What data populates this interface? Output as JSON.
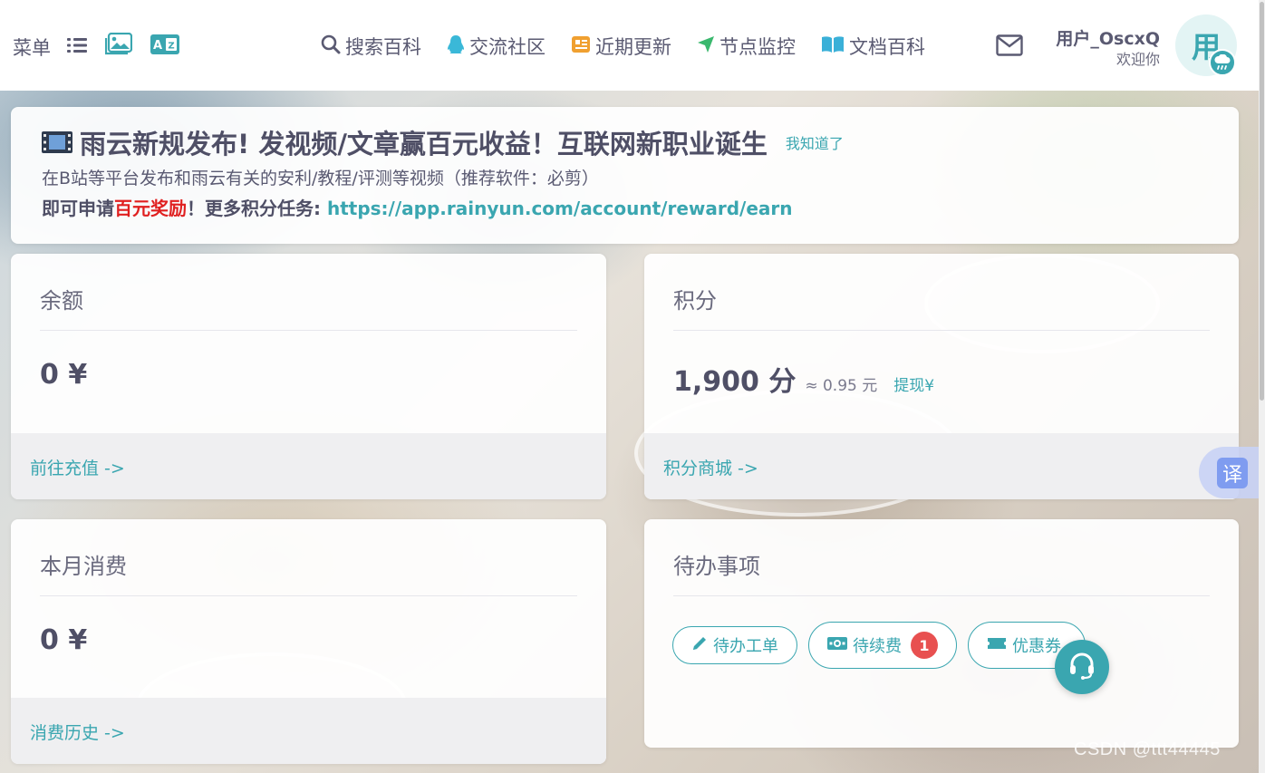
{
  "header": {
    "menu_label": "菜单",
    "nav": [
      {
        "label": "搜索百科",
        "icon": "search-icon"
      },
      {
        "label": "交流社区",
        "icon": "qq-penguin-icon"
      },
      {
        "label": "近期更新",
        "icon": "notebook-icon"
      },
      {
        "label": "节点监控",
        "icon": "location-arrow-icon"
      },
      {
        "label": "文档百科",
        "icon": "open-book-icon"
      }
    ],
    "user_name": "用户_OscxQ",
    "user_greeting": "欢迎你",
    "avatar_char": "用"
  },
  "notice": {
    "icon": "film-icon",
    "title": "雨云新规发布! 发视频/文章赢百元收益！互联网新职业诞生",
    "ack_label": "我知道了",
    "subtitle": "在B站等平台发布和雨云有关的安利/教程/评测等视频（推荐软件：必剪）",
    "line_prefix": "即可申请",
    "line_highlight": "百元奖励",
    "line_mid": "！更多积分任务: ",
    "line_link": "https://app.rainyun.com/account/reward/earn"
  },
  "cards": {
    "balance": {
      "title": "余额",
      "value": "0 ¥",
      "footer": "前往充值 ->"
    },
    "points": {
      "title": "积分",
      "value": "1,900 分",
      "approx": "≈ 0.95 元",
      "withdraw": "提现¥",
      "footer": "积分商城 ->"
    },
    "month": {
      "title": "本月消费",
      "value": "0 ¥",
      "footer": "消费历史 ->"
    },
    "todo": {
      "title": "待办事项",
      "items": [
        {
          "label": "待办工单",
          "icon": "pencil-icon",
          "badge": ""
        },
        {
          "label": "待续费",
          "icon": "money-bill-icon",
          "badge": "1"
        },
        {
          "label": "优惠券",
          "icon": "ticket-icon",
          "badge": ""
        }
      ]
    }
  },
  "floating": {
    "translate_char": "译",
    "watermark": "CSDN @ttt44445"
  },
  "colors": {
    "accent": "#3aa6b0",
    "text": "#5a5a72",
    "highlight_red": "#e02020",
    "badge_red": "#e85050"
  }
}
